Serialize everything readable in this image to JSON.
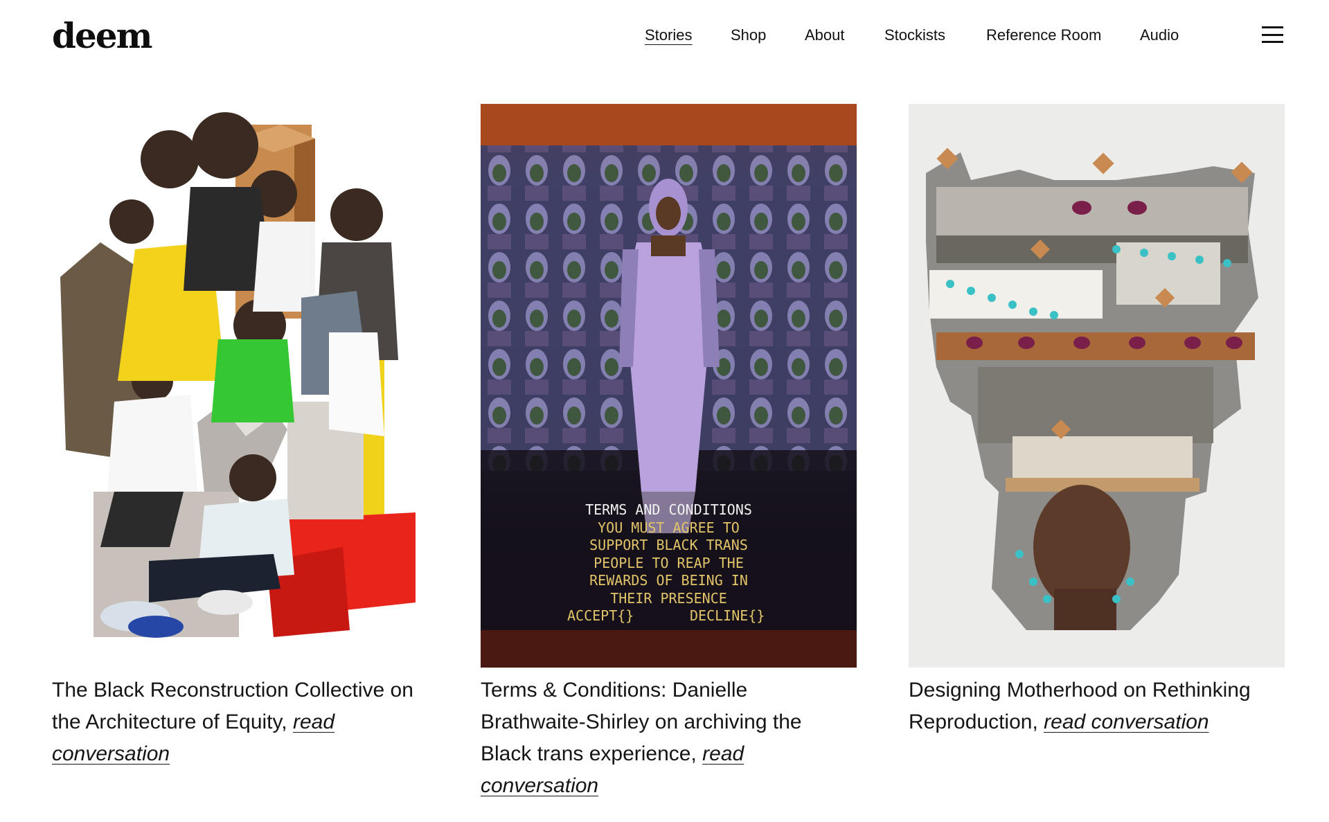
{
  "brand": {
    "logo": "deem"
  },
  "nav": {
    "items": [
      {
        "label": "Stories",
        "active": true
      },
      {
        "label": "Shop",
        "active": false
      },
      {
        "label": "About",
        "active": false
      },
      {
        "label": "Stockists",
        "active": false
      },
      {
        "label": "Reference Room",
        "active": false
      },
      {
        "label": "Audio",
        "active": false
      }
    ],
    "menu_icon": "hamburger-menu-icon"
  },
  "stories": [
    {
      "title": "The Black Reconstruction Collective on the Architecture of Equity,",
      "link": "read conversation",
      "image": "collage-of-people-portraits"
    },
    {
      "title": "Terms & Conditions: Danielle Brathwaite-Shirley on archiving the Black trans experience,",
      "link": "read conversation",
      "image": "digital-avatar-terms-and-conditions",
      "overlay_text": {
        "line1": "TERMS AND CONDITIONS",
        "line2": "YOU MUST AGREE TO",
        "line3": "SUPPORT BLACK TRANS",
        "line4": "PEOPLE TO REAP THE",
        "line5": "REWARDS OF BEING IN",
        "line6": "THEIR PRESENCE",
        "accept": "ACCEPT{}",
        "decline": "DECLINE{}"
      }
    },
    {
      "title": "Designing Motherhood on Rethinking Reproduction,",
      "link": "read conversation",
      "image": "collage-headdress-portrait"
    }
  ],
  "colors": {
    "text": "#111111",
    "overlay_white": "#f2f2f2",
    "overlay_gold": "#e2c46a",
    "card3_bg": "#ececea"
  }
}
